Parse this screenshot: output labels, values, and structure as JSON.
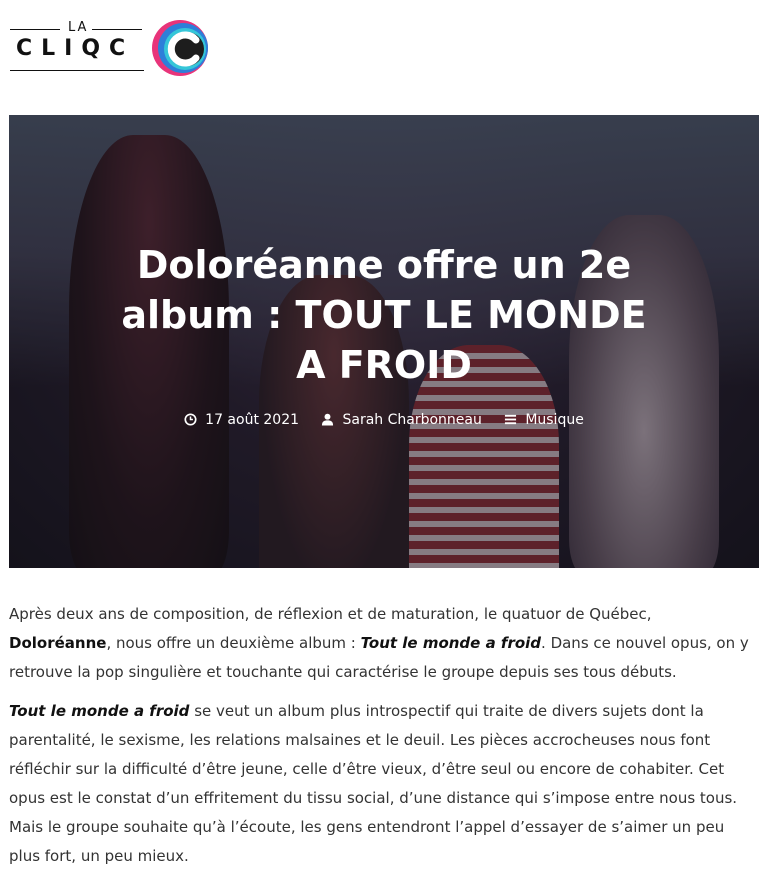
{
  "logo": {
    "top_text": "LA",
    "main_text": "CLIQC",
    "mark_letter": "C",
    "colors": {
      "pink": "#e8347a",
      "blue": "#2d7fd9",
      "cyan": "#35c6d8",
      "dark": "#1d1d1d"
    }
  },
  "hero": {
    "title": "Doloréanne offre un 2e album : TOUT LE MONDE A FROID",
    "date": "17 août 2021",
    "author": "Sarah Charbonneau",
    "category": "Musique",
    "icons": {
      "date": "clock-icon",
      "author": "user-icon",
      "category": "menu-icon"
    }
  },
  "article": {
    "p1_part1": "Après deux ans de composition, de réflexion et de maturation, le quatuor de Québec, ",
    "p1_band": "Doloréanne",
    "p1_part2": ", nous offre un deuxième album : ",
    "p1_album": "Tout le monde a froid",
    "p1_part3": ". Dans ce nouvel opus, on y retrouve la pop singulière et touchante qui caractérise le groupe depuis ses tous débuts.",
    "p2_album": "Tout le monde a froid",
    "p2_rest": " se veut un album plus introspectif qui traite de divers sujets dont la parentalité, le sexisme, les relations malsaines et le deuil. Les pièces accrocheuses nous font réfléchir sur la difficulté d’être jeune, celle d’être vieux, d’être seul ou encore de cohabiter. Cet opus est le constat d’un effritement du tissu social, d’une distance qui s’impose entre nous tous. Mais le groupe souhaite qu’à l’écoute, les gens entendront l’appel d’essayer de s’aimer un peu plus fort, un peu mieux."
  }
}
